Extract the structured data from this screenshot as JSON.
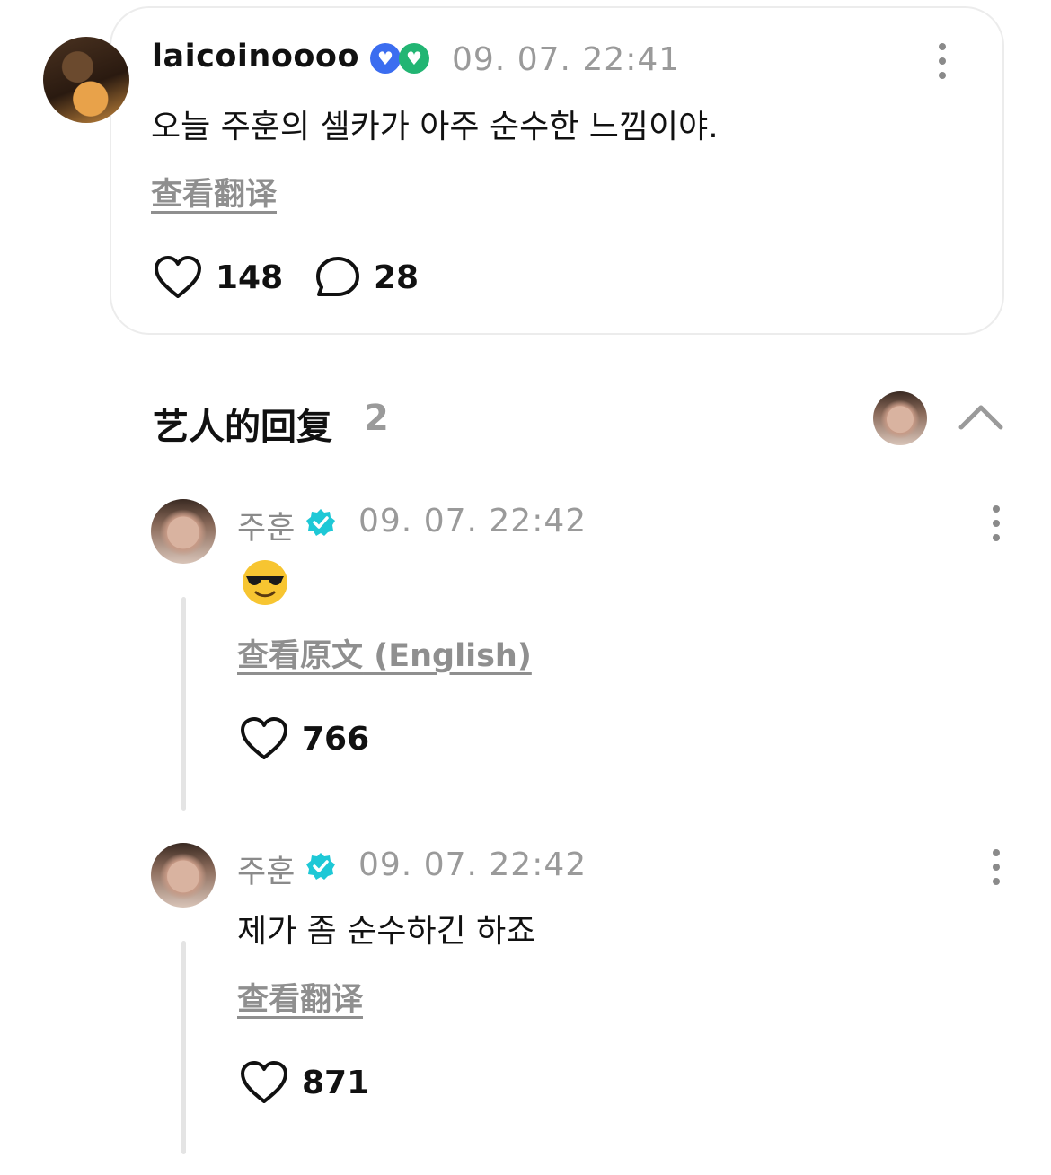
{
  "post": {
    "username": "laicoinoooo",
    "timestamp": "09. 07. 22:41",
    "text": "오늘 주훈의 셀카가 아주 순수한 느낌이야.",
    "translate_label": "查看翻译",
    "likes": "148",
    "comments": "28"
  },
  "artist_replies": {
    "title": "艺人的回复",
    "count": "2",
    "replies": [
      {
        "name": "주훈",
        "timestamp": "09. 07. 22:42",
        "emoji": "😎",
        "original_label": "查看原文",
        "original_lang": " (English)",
        "likes": "766"
      },
      {
        "name": "주훈",
        "timestamp": "09. 07. 22:42",
        "text": "제가 좀 순수하긴 하죠",
        "translate_label": "查看翻译",
        "likes": "871"
      }
    ]
  },
  "colors": {
    "verified": "#1ec8d6",
    "muted": "#8f8f8f",
    "badge_blue": "#3b6df0",
    "badge_green": "#22b573"
  }
}
